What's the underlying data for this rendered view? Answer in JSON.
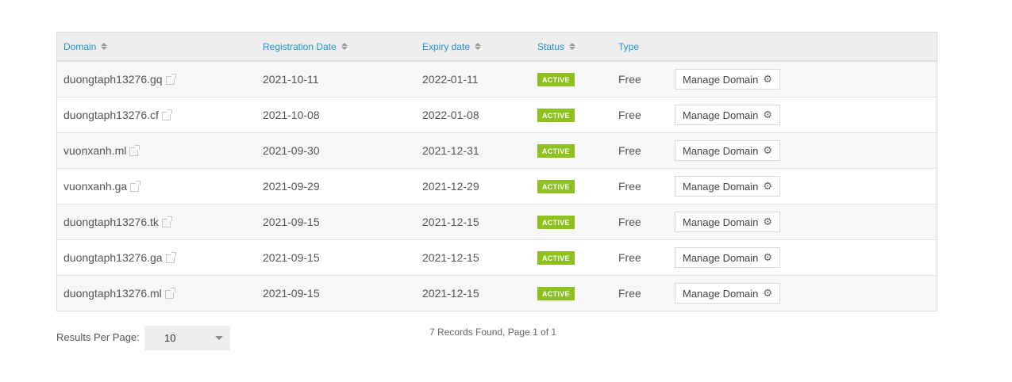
{
  "table": {
    "headers": {
      "domain": "Domain",
      "registration": "Registration Date",
      "expiry": "Expiry date",
      "status": "Status",
      "type": "Type"
    },
    "rows": [
      {
        "domain": "duongtaph13276.gq",
        "reg": "2021-10-11",
        "exp": "2022-01-11",
        "status": "ACTIVE",
        "type": "Free",
        "action": "Manage Domain"
      },
      {
        "domain": "duongtaph13276.cf",
        "reg": "2021-10-08",
        "exp": "2022-01-08",
        "status": "ACTIVE",
        "type": "Free",
        "action": "Manage Domain"
      },
      {
        "domain": "vuonxanh.ml",
        "reg": "2021-09-30",
        "exp": "2021-12-31",
        "status": "ACTIVE",
        "type": "Free",
        "action": "Manage Domain"
      },
      {
        "domain": "vuonxanh.ga",
        "reg": "2021-09-29",
        "exp": "2021-12-29",
        "status": "ACTIVE",
        "type": "Free",
        "action": "Manage Domain"
      },
      {
        "domain": "duongtaph13276.tk",
        "reg": "2021-09-15",
        "exp": "2021-12-15",
        "status": "ACTIVE",
        "type": "Free",
        "action": "Manage Domain"
      },
      {
        "domain": "duongtaph13276.ga",
        "reg": "2021-09-15",
        "exp": "2021-12-15",
        "status": "ACTIVE",
        "type": "Free",
        "action": "Manage Domain"
      },
      {
        "domain": "duongtaph13276.ml",
        "reg": "2021-09-15",
        "exp": "2021-12-15",
        "status": "ACTIVE",
        "type": "Free",
        "action": "Manage Domain"
      }
    ]
  },
  "footer": {
    "results_label": "Results Per Page:",
    "per_page": "10",
    "records_text": "7 Records Found, Page 1 of 1"
  },
  "colors": {
    "header_link": "#1e93cf",
    "active_badge": "#8cc11f"
  },
  "icons": {
    "sort": "sort-icon",
    "external": "external-link-icon",
    "gear": "gear-icon",
    "dropdown": "chevron-down-icon"
  }
}
